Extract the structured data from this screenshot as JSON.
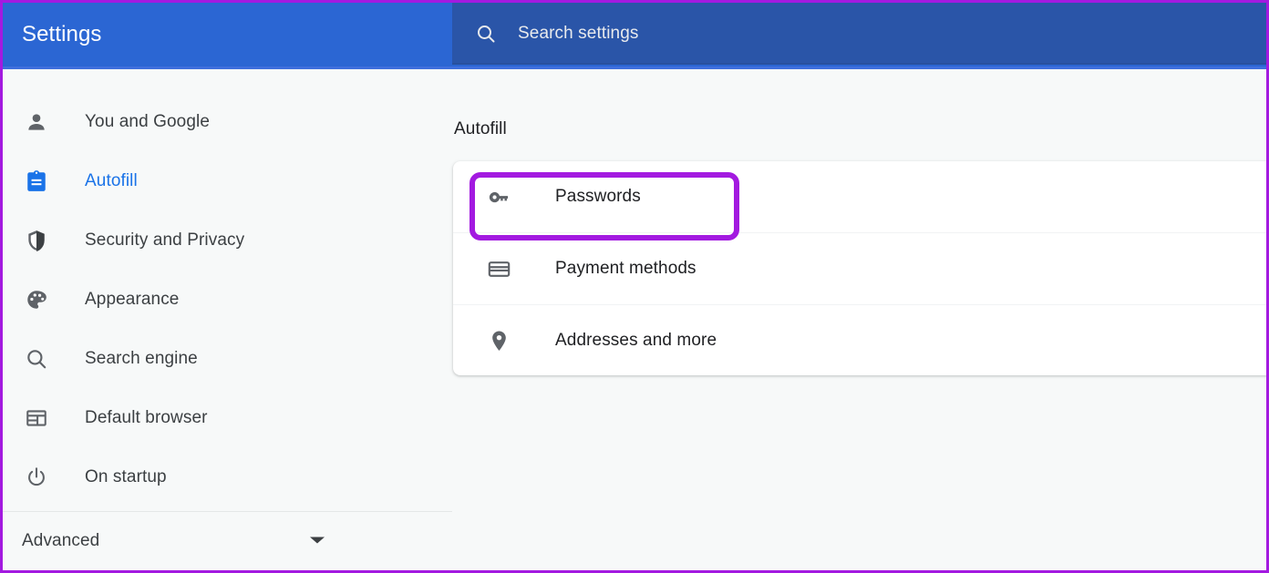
{
  "header": {
    "title": "Settings",
    "search": {
      "placeholder": "Search settings",
      "value": "",
      "icon": "search-icon"
    }
  },
  "sidebar": {
    "items": [
      {
        "label": "You and Google",
        "icon": "person-icon",
        "active": false
      },
      {
        "label": "Autofill",
        "icon": "clipboard-icon",
        "active": true
      },
      {
        "label": "Security and Privacy",
        "icon": "shield-icon",
        "active": false
      },
      {
        "label": "Appearance",
        "icon": "palette-icon",
        "active": false
      },
      {
        "label": "Search engine",
        "icon": "search-icon",
        "active": false
      },
      {
        "label": "Default browser",
        "icon": "browser-window-icon",
        "active": false
      },
      {
        "label": "On startup",
        "icon": "power-icon",
        "active": false
      }
    ],
    "advanced": {
      "label": "Advanced",
      "icon": "chevron-down-icon"
    }
  },
  "main": {
    "page_title": "Autofill",
    "rows": [
      {
        "label": "Passwords",
        "icon": "key-icon",
        "highlighted": true
      },
      {
        "label": "Payment methods",
        "icon": "credit-card-icon",
        "highlighted": false
      },
      {
        "label": "Addresses and more",
        "icon": "location-pin-icon",
        "highlighted": false
      }
    ]
  },
  "colors": {
    "header_blue": "#2b66d3",
    "search_blue": "#2a55a8",
    "accent_blue": "#1a73e8",
    "annotation_purple": "#a31ae0",
    "page_background": "#f7f9f9",
    "card_white": "#ffffff",
    "text_primary": "#202124",
    "text_secondary": "#3c4043"
  }
}
